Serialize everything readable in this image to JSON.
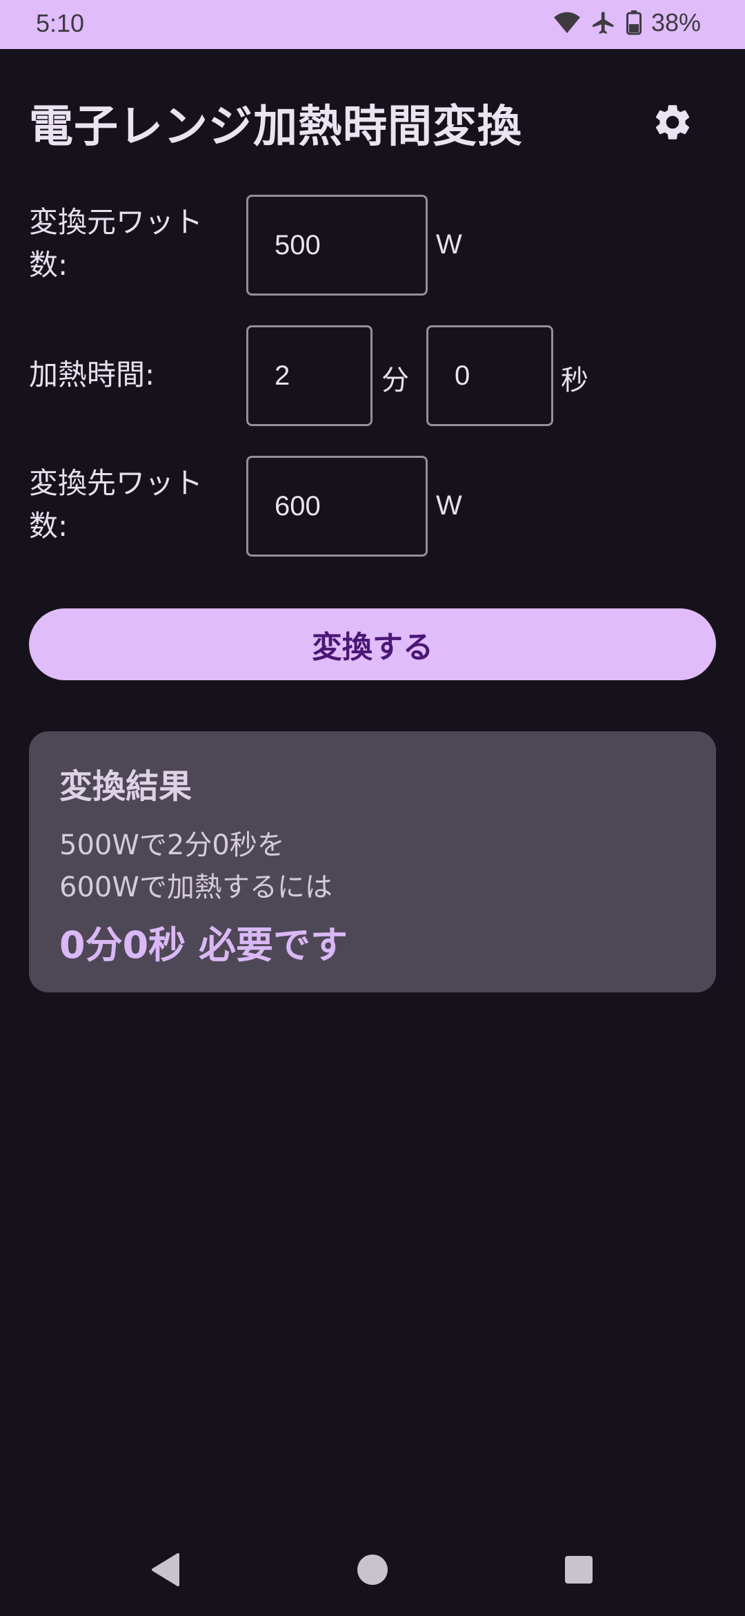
{
  "status": {
    "time": "5:10",
    "battery_pct": "38%",
    "icons": [
      "wifi-icon",
      "airplane-icon",
      "battery-icon"
    ]
  },
  "app": {
    "title": "電子レンジ加熱時間変換",
    "settings_icon": "gear-icon"
  },
  "form": {
    "source_watt_label": "変換元ワット数:",
    "source_watt_value": "500",
    "source_watt_unit": "W",
    "time_label": "加熱時間:",
    "minutes_value": "2",
    "minutes_unit": "分",
    "seconds_value": "0",
    "seconds_unit": "秒",
    "target_watt_label": "変換先ワット数:",
    "target_watt_value": "600",
    "target_watt_unit": "W"
  },
  "convert_button_label": "変換する",
  "result": {
    "title": "変換結果",
    "line1": "500Wで2分0秒を",
    "line2": "600Wで加熱するには",
    "emphasis": "0分0秒 必要です"
  },
  "nav": [
    "back-icon",
    "home-icon",
    "recents-icon"
  ],
  "colors": {
    "accent": "#e0bcfa",
    "background": "#16121b",
    "card": "#4e4756",
    "button_text": "#4a1774"
  }
}
